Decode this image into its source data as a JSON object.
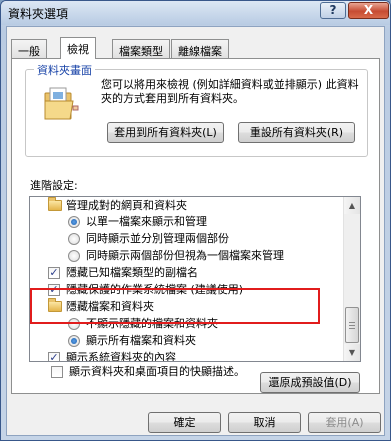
{
  "window": {
    "title": "資料夾選項",
    "help": "?",
    "close": "X"
  },
  "tabs": [
    {
      "label": "一般"
    },
    {
      "label": "檢視"
    },
    {
      "label": "檔案類型"
    },
    {
      "label": "離線檔案"
    }
  ],
  "folder_view": {
    "legend": "資料夾畫面",
    "description": "您可以將用來檢視 (例如詳細資料或並排顯示) 此資料夾的方式套用到所有資料夾。",
    "apply_all": "套用到所有資料夾(L)",
    "reset_all": "重設所有資料夾(R)"
  },
  "advanced": {
    "label": "進階設定:",
    "items": [
      {
        "type": "folder",
        "text": "管理成對的網頁和資料夾"
      },
      {
        "type": "radio",
        "checked": true,
        "text": "以單一檔案來顯示和管理"
      },
      {
        "type": "radio",
        "checked": false,
        "text": "同時顯示並分別管理兩個部份"
      },
      {
        "type": "radio",
        "checked": false,
        "text": "同時顯示兩個部份但視為一個檔案來管理"
      },
      {
        "type": "checkbox",
        "checked": true,
        "text": "隱藏已知檔案類型的副檔名"
      },
      {
        "type": "checkbox",
        "checked": true,
        "text": "隱藏保護的作業系統檔案 (建議使用)"
      },
      {
        "type": "folder",
        "text": "隱藏檔案和資料夾"
      },
      {
        "type": "radio",
        "checked": false,
        "text": "不顯示隱藏的檔案和資料夾"
      },
      {
        "type": "radio",
        "checked": true,
        "text": "顯示所有檔案和資料夾"
      },
      {
        "type": "checkbox",
        "checked": true,
        "text": "顯示系統資料夾的內容"
      },
      {
        "type": "checkbox",
        "checked": false,
        "text": "顯示資料夾和桌面項目的快顯描述。"
      }
    ]
  },
  "restore_defaults": "還原成預設值(D)",
  "footer": {
    "ok": "確定",
    "cancel": "取消",
    "apply": "套用(A)"
  },
  "highlight_color": "#e11c1c"
}
